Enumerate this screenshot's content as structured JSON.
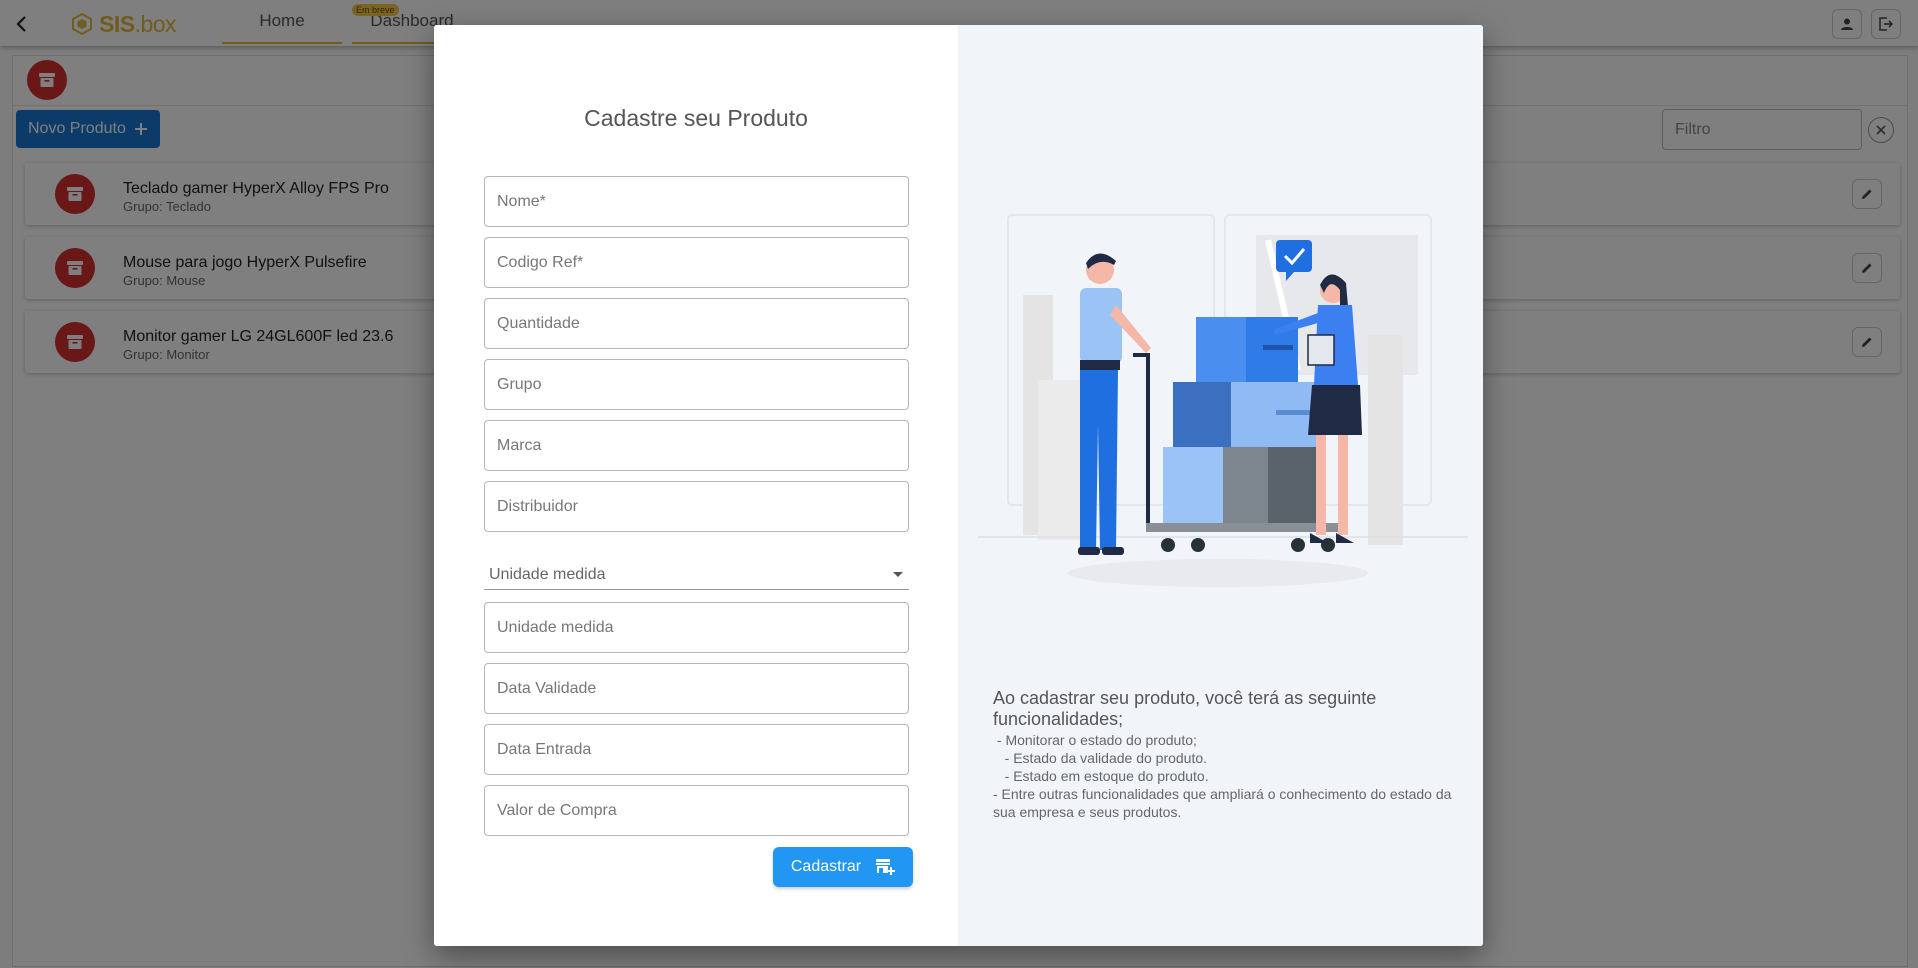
{
  "app": {
    "brand": {
      "prefix": "SIS",
      "suffix": ".box"
    },
    "nav": {
      "home_label": "Home",
      "dashboard_label": "Dashboard",
      "dashboard_badge": "Em breve"
    }
  },
  "page": {
    "new_product_label": "Novo Produto",
    "filter_placeholder": "Filtro",
    "products": [
      {
        "name": "Teclado gamer HyperX Alloy FPS Pro",
        "group": "Grupo: Teclado"
      },
      {
        "name": "Mouse para jogo HyperX Pulsefire",
        "group": "Grupo: Mouse"
      },
      {
        "name": "Monitor gamer LG 24GL600F led 23.6",
        "group": "Grupo: Monitor"
      }
    ]
  },
  "modal": {
    "title": "Cadastre seu Produto",
    "fields": {
      "nome": "Nome*",
      "codigo": "Codigo Ref*",
      "quantidade": "Quantidade",
      "grupo": "Grupo",
      "marca": "Marca",
      "distribuidor": "Distribuidor",
      "unidade_select": "Unidade medida",
      "unidade": "Unidade medida",
      "validade": "Data Validade",
      "entrada": "Data Entrada",
      "valor": "Valor de Compra"
    },
    "submit_label": "Cadastrar",
    "info": {
      "title": "Ao cadastrar seu produto, você terá as seguinte funcionalidades;",
      "lines": [
        " - Monitorar o estado do produto;",
        "   - Estado da validade do produto.",
        "   - Estado em estoque do produto.",
        " - Entre outras funcionalidades que ampliará o conhecimento do estado da sua empresa e seus produtos."
      ]
    }
  },
  "colors": {
    "brand": "#e0b83a",
    "primary": "#1976d2",
    "submit": "#2196f3",
    "product_icon": "#d32f2f",
    "modal_right_bg": "#f1f4f8"
  },
  "icons": [
    "back-arrow-icon",
    "logo-hexagon-icon",
    "user-icon",
    "logout-icon",
    "archive-box-icon",
    "plus-icon",
    "close-icon",
    "edit-pencil-icon",
    "chevron-down-icon",
    "store-add-icon"
  ]
}
